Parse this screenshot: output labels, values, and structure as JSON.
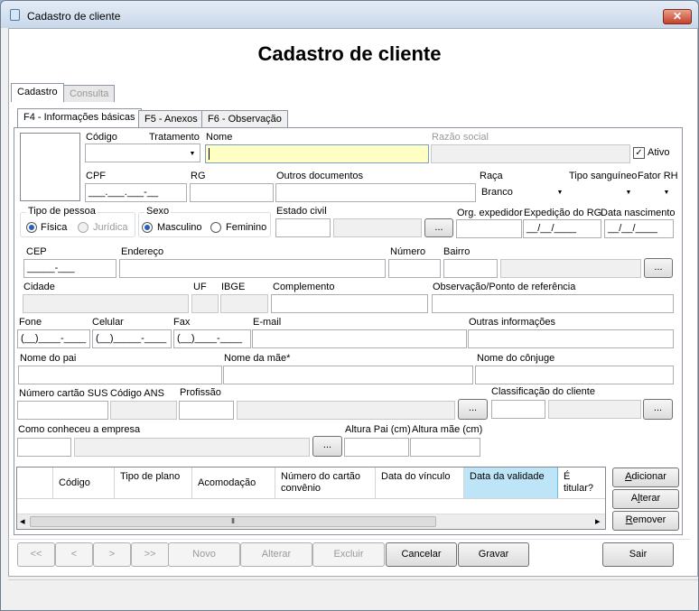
{
  "window": {
    "title": "Cadastro de cliente",
    "close": "✕"
  },
  "heading": "Cadastro de cliente",
  "outer_tabs": [
    "Cadastro",
    "Consulta"
  ],
  "inner_tabs": [
    "F4 - Informações básicas",
    "F5 - Anexos",
    "F6 - Observação"
  ],
  "labels": {
    "codigo": "Código",
    "tratamento": "Tratamento",
    "nome": "Nome",
    "razao": "Razão social",
    "ativo": "Ativo",
    "cpf": "CPF",
    "rg": "RG",
    "outros_doc": "Outros documentos",
    "raca": "Raça",
    "tipo_sangue": "Tipo sanguíneo",
    "fator_rh": "Fator RH",
    "tipo_pessoa": "Tipo de pessoa",
    "fisica": "Física",
    "juridica": "Jurídica",
    "sexo": "Sexo",
    "masculino": "Masculino",
    "feminino": "Feminino",
    "estado_civil": "Estado civil",
    "org_exp": "Org. expedidor",
    "exp_rg": "Expedição do RG",
    "data_nasc": "Data nascimento",
    "cep": "CEP",
    "endereco": "Endereço",
    "numero": "Número",
    "bairro": "Bairro",
    "cidade": "Cidade",
    "uf": "UF",
    "ibge": "IBGE",
    "complemento": "Complemento",
    "obs_ref": "Observação/Ponto de referência",
    "fone": "Fone",
    "celular": "Celular",
    "fax": "Fax",
    "email": "E-mail",
    "outras_info": "Outras informações",
    "nome_pai": "Nome do pai",
    "nome_mae": "Nome da mãe*",
    "nome_conjuge": "Nome do cônjuge",
    "cartao_sus": "Número cartão SUS",
    "codigo_ans": "Código ANS",
    "profissao": "Profissão",
    "classificacao": "Classificação do cliente",
    "como_conheceu": "Como conheceu a empresa",
    "altura_pai": "Altura Pai (cm)",
    "altura_mae": "Altura mãe (cm)"
  },
  "values": {
    "cpf": "___.___.___-__",
    "raca": "Branco",
    "exp_rg": "__/__/____",
    "data_nasc": "__/__/____",
    "cep": "_____-___",
    "fone": "(__)____-____",
    "celular": "(__)_____-____",
    "fax": "(__)____-____",
    "ellipsis": "...",
    "dropdown": "▼"
  },
  "grid": {
    "columns": [
      "Código",
      "Tipo de plano",
      "Acomodação",
      "Número do cartão convênio",
      "Data do vínculo",
      "Data da validade",
      "É titular?"
    ],
    "scroll_left": "◂",
    "scroll_right": "▸",
    "scroll_grip": "⦀"
  },
  "grid_buttons": {
    "adicionar_u": "A",
    "adicionar_rest": "dicionar",
    "alterar_pre": "A",
    "alterar_u": "l",
    "alterar_rest": "terar",
    "remover_u": "R",
    "remover_rest": "emover"
  },
  "nav_buttons": {
    "first": "<<",
    "prev": "<",
    "next": ">",
    "last": ">>",
    "novo": "Novo",
    "alterar": "Alterar",
    "excluir": "Excluir",
    "cancelar": "Cancelar",
    "gravar": "Gravar",
    "sair": "Sair"
  }
}
